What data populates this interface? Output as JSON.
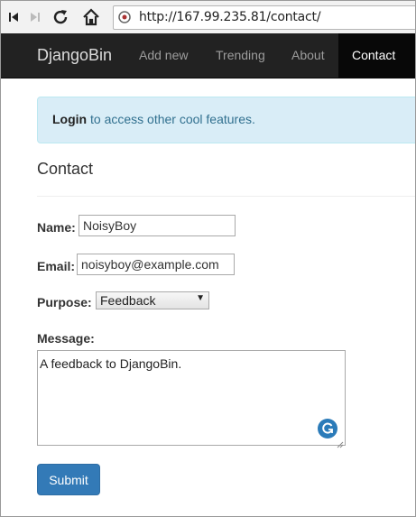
{
  "browser": {
    "url": "http://167.99.235.81/contact/",
    "icons": [
      "first-page-icon",
      "last-page-icon",
      "reload-icon",
      "home-icon",
      "site-info-icon"
    ]
  },
  "navbar": {
    "brand": "DjangoBin",
    "items": [
      {
        "label": "Add new"
      },
      {
        "label": "Trending"
      },
      {
        "label": "About"
      },
      {
        "label": "Contact",
        "active": true
      }
    ]
  },
  "alert": {
    "link": "Login",
    "text": " to access other cool features."
  },
  "page": {
    "title": "Contact"
  },
  "form": {
    "name_label": "Name:",
    "name_value": "NoisyBoy",
    "email_label": "Email:",
    "email_value": "noisyboy@example.com",
    "purpose_label": "Purpose:",
    "purpose_value": "Feedback",
    "message_label": "Message:",
    "message_value": "A feedback to DjangoBin.",
    "submit_label": "Submit"
  },
  "colors": {
    "navbar_bg": "#222222",
    "active_nav_bg": "#080808",
    "alert_bg": "#d9edf7",
    "alert_text": "#31708f",
    "primary": "#337ab7"
  }
}
